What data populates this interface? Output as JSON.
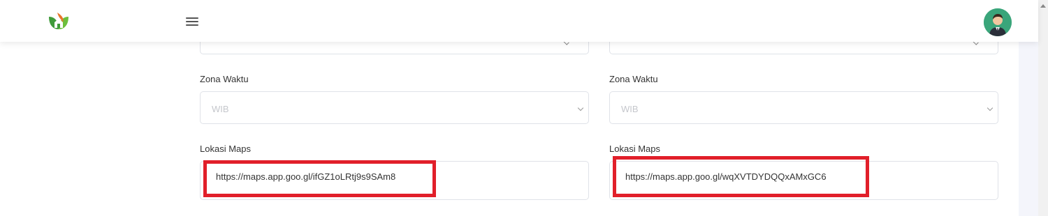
{
  "header": {
    "logo_icon": "leaf-house-logo-icon",
    "menu_icon": "hamburger-icon",
    "avatar_icon": "user-avatar-icon"
  },
  "form": {
    "left": {
      "timezone_label": "Zona Waktu",
      "timezone_value": "WIB",
      "maps_label": "Lokasi Maps",
      "maps_value": "https://maps.app.goo.gl/ifGZ1oLRtj9s9SAm8"
    },
    "right": {
      "timezone_label": "Zona Waktu",
      "timezone_value": "WIB",
      "maps_label": "Lokasi Maps",
      "maps_value": "https://maps.app.goo.gl/wqXVTDYDQQxAMxGC6"
    }
  },
  "colors": {
    "highlight": "#e11f2a",
    "avatar_bg": "#3aa57a",
    "page_bg": "#f4f5fb"
  }
}
